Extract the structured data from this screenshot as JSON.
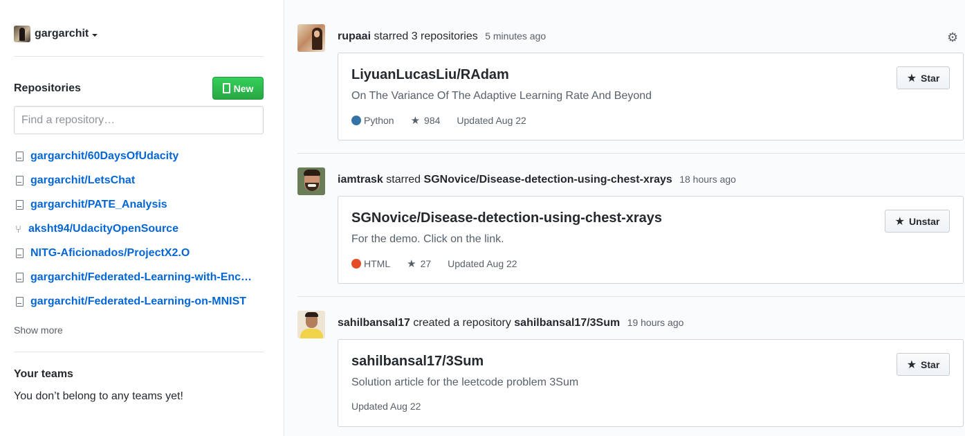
{
  "sidebar": {
    "username": "gargarchit",
    "repositories_title": "Repositories",
    "new_button": "New",
    "find_placeholder": "Find a repository…",
    "repos": [
      {
        "name": "gargarchit/60DaysOfUdacity",
        "icon": "repo-icon"
      },
      {
        "name": "gargarchit/LetsChat",
        "icon": "repo-icon"
      },
      {
        "name": "gargarchit/PATE_Analysis",
        "icon": "repo-icon"
      },
      {
        "name": "aksht94/UdacityOpenSource",
        "icon": "fork-icon"
      },
      {
        "name": "NITG-Aficionados/ProjectX2.O",
        "icon": "repo-icon"
      },
      {
        "name": "gargarchit/Federated-Learning-with-Enc…",
        "icon": "repo-icon"
      },
      {
        "name": "gargarchit/Federated-Learning-on-MNIST",
        "icon": "repo-icon"
      }
    ],
    "show_more": "Show more",
    "teams_title": "Your teams",
    "teams_text": "You don’t belong to any teams yet!"
  },
  "feed": [
    {
      "actor": "rupaai",
      "action": "starred 3 repositories",
      "target": "",
      "time": "5 minutes ago",
      "card": {
        "title": "LiyuanLucasLiu/RAdam",
        "description": "On The Variance Of The Adaptive Learning Rate And Beyond",
        "language": "Python",
        "language_color": "#3572A5",
        "stars": "984",
        "updated": "Updated Aug 22",
        "star_button": "Star"
      }
    },
    {
      "actor": "iamtrask",
      "action": "starred",
      "target": "SGNovice/Disease-detection-using-chest-xrays",
      "time": "18 hours ago",
      "card": {
        "title": "SGNovice/Disease-detection-using-chest-xrays",
        "description": "For the demo. Click on the link.",
        "language": "HTML",
        "language_color": "#e34c26",
        "stars": "27",
        "updated": "Updated Aug 22",
        "star_button": "Unstar"
      }
    },
    {
      "actor": "sahilbansal17",
      "action": "created a repository",
      "target": "sahilbansal17/3Sum",
      "time": "19 hours ago",
      "card": {
        "title": "sahilbansal17/3Sum",
        "description": "Solution article for the leetcode problem 3Sum",
        "updated": "Updated Aug 22",
        "star_button": "Star"
      }
    }
  ]
}
